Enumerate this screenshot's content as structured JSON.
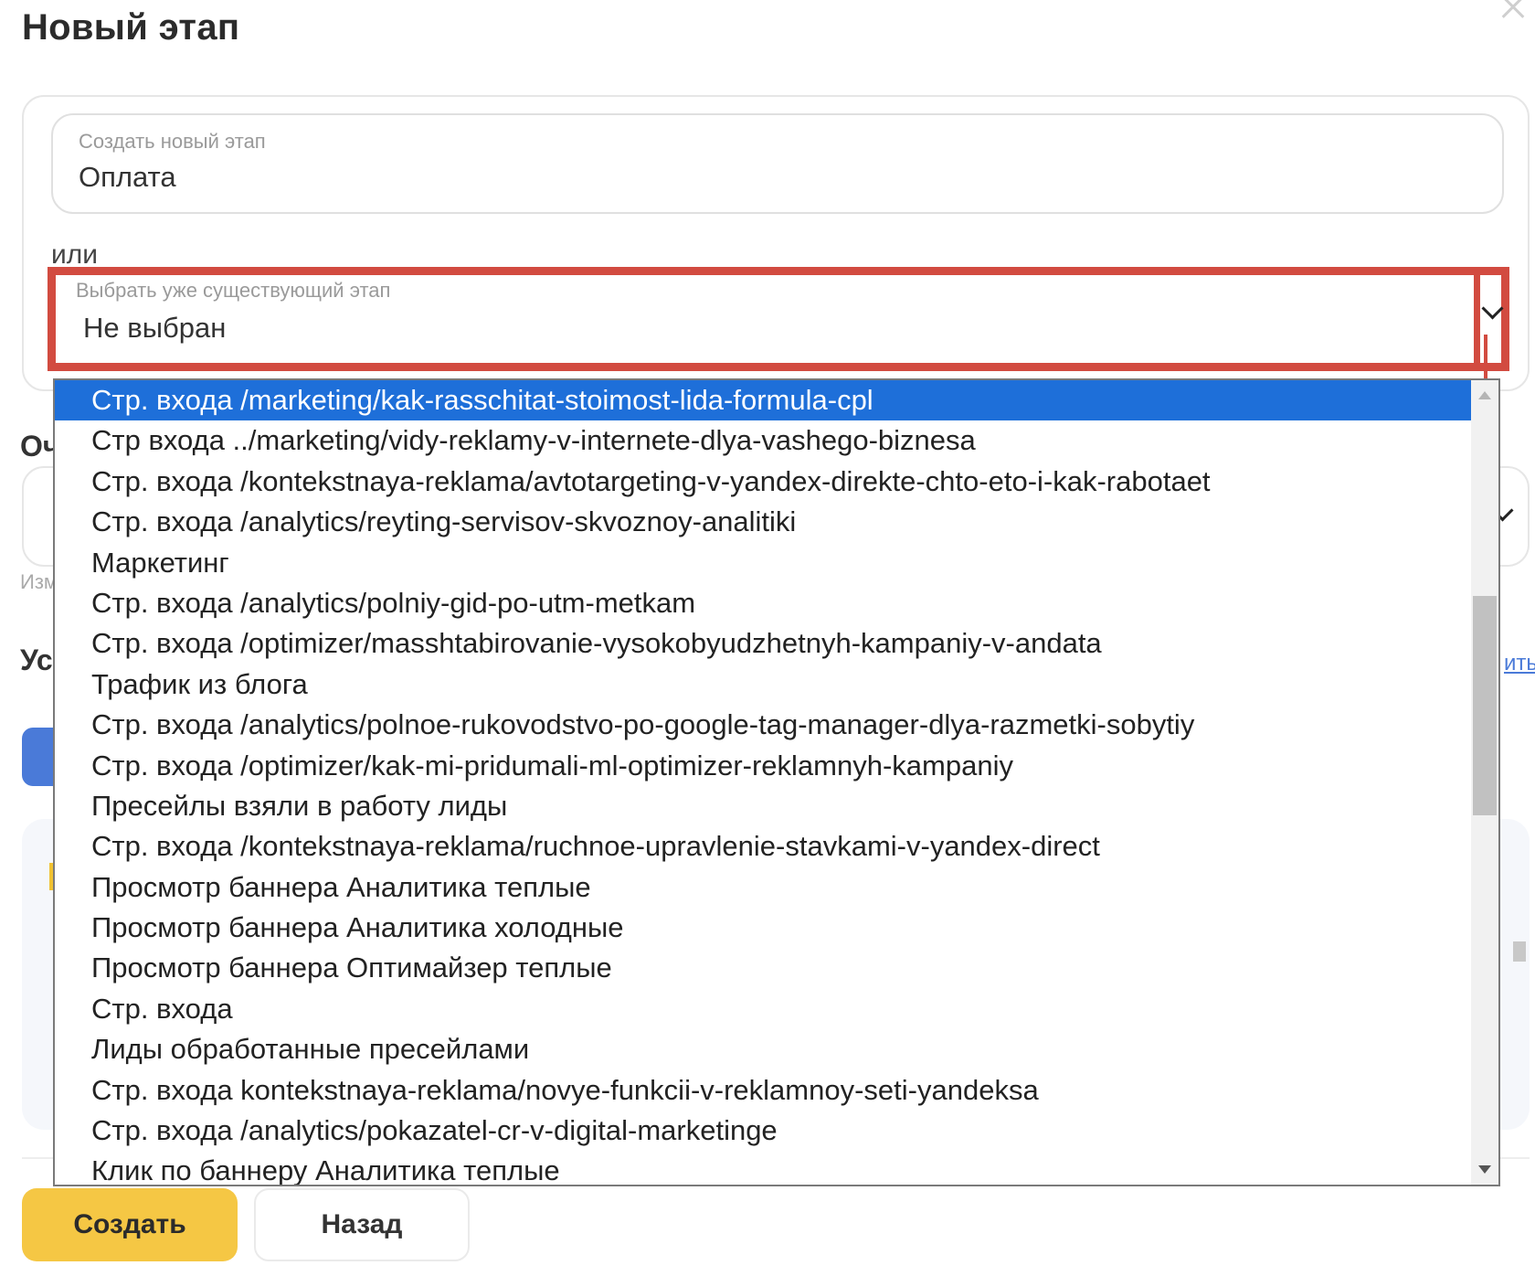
{
  "dialog": {
    "title": "Новый этап",
    "or_label": "или"
  },
  "new_stage": {
    "label": "Создать новый этап",
    "value": "Оплата"
  },
  "existing_stage": {
    "label": "Выбрать уже существующий этап",
    "value": "Не выбран"
  },
  "background": {
    "label_ochered": "Оч",
    "hint": "Изм",
    "label_us": "Ус",
    "link": "ить"
  },
  "dropdown": {
    "options": [
      "Стр. входа /marketing/kak-rasschitat-stoimost-lida-formula-cpl",
      "Стр входа ../marketing/vidy-reklamy-v-internete-dlya-vashego-biznesa",
      "Стр. входа /kontekstnaya-reklama/avtotargeting-v-yandex-direkte-chto-eto-i-kak-rabotaet",
      "Стр. входа /analytics/reyting-servisov-skvoznoy-analitiki",
      "Маркетинг",
      "Стр. входа /analytics/polniy-gid-po-utm-metkam",
      "Стр. входа /optimizer/masshtabirovanie-vysokobyudzhetnyh-kampaniy-v-andata",
      "Трафик из блога",
      "Стр. входа /analytics/polnoe-rukovodstvo-po-google-tag-manager-dlya-razmetki-sobytiy",
      "Стр. входа /optimizer/kak-mi-pridumali-ml-optimizer-reklamnyh-kampaniy",
      "Пресейлы взяли в работу лиды",
      "Стр. входа /kontekstnaya-reklama/ruchnoe-upravlenie-stavkami-v-yandex-direct",
      "Просмотр баннера Аналитика теплые",
      "Просмотр баннера Аналитика холодные",
      "Просмотр баннера Оптимайзер теплые",
      "Стр. входа",
      "Лиды обработанные пресейлами",
      "Стр. входа kontekstnaya-reklama/novye-funkcii-v-reklamnoy-seti-yandeksa",
      "Стр. входа /analytics/pokazatel-cr-v-digital-marketinge",
      "Клик по баннеру Аналитика теплые"
    ]
  },
  "buttons": {
    "create": "Создать",
    "back": "Назад"
  },
  "colors": {
    "highlight_border": "#d24b40",
    "selected_option": "#1e6fd9",
    "primary_button": "#f5c744"
  }
}
